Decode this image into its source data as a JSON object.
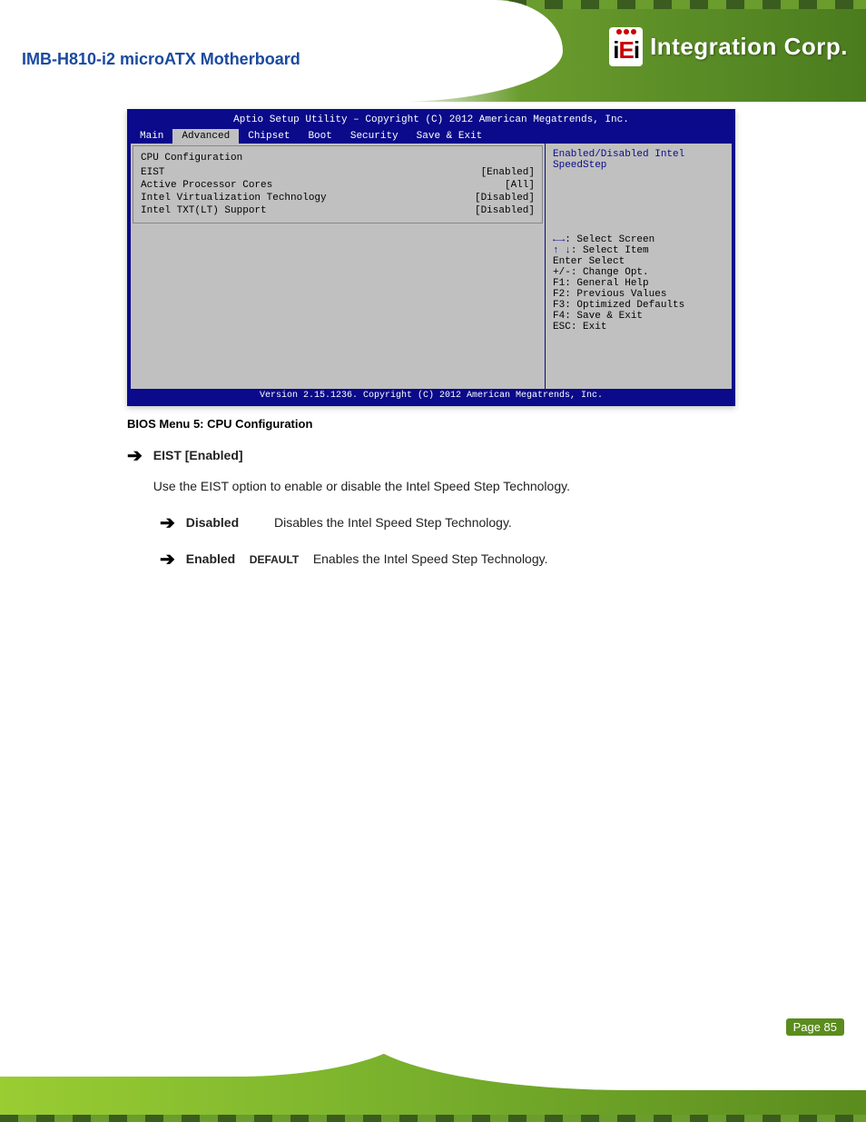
{
  "product_title": "IMB-H810-i2 microATX Motherboard",
  "brand": {
    "logo_text_1": "i",
    "logo_text_2": "E",
    "logo_text_3": "i",
    "tagline": "Integration Corp."
  },
  "bios": {
    "setup_title": "Aptio Setup Utility – Copyright (C) 2012 American Megatrends, Inc.",
    "tabs": [
      "Main",
      "Advanced",
      "Chipset",
      "Boot",
      "Security",
      "Save & Exit"
    ],
    "active_tab_index": 1,
    "left_rows": [
      {
        "opt": "CPU Configuration",
        "val": ""
      },
      {
        "opt": "",
        "val": ""
      },
      {
        "opt": "EIST",
        "val": "[Enabled]"
      },
      {
        "opt": "Active Processor Cores",
        "val": "[All]"
      },
      {
        "opt": "Intel Virtualization Technology",
        "val": "[Disabled]"
      },
      {
        "opt": "Intel TXT(LT) Support",
        "val": "[Disabled]"
      }
    ],
    "help_text": "Enabled/Disabled Intel SpeedStep",
    "keys": [
      {
        "sym": "←→",
        "txt": ": Select Screen"
      },
      {
        "sym": "↑ ↓",
        "txt": ": Select Item"
      },
      {
        "sym": "Enter",
        "txt": "Select"
      },
      {
        "sym": "+/-",
        "txt": ": Change Opt."
      },
      {
        "sym": "F1",
        "txt": ": General Help"
      },
      {
        "sym": "F2",
        "txt": ": Previous Values"
      },
      {
        "sym": "F3",
        "txt": ": Optimized Defaults"
      },
      {
        "sym": "F4",
        "txt": ": Save & Exit"
      },
      {
        "sym": "ESC",
        "txt": ": Exit"
      }
    ],
    "footer": "Version 2.15.1236. Copyright (C) 2012 American Megatrends, Inc."
  },
  "figure_caption": "BIOS Menu 5: CPU Configuration",
  "eist_block": {
    "heading": "EIST [Enabled]",
    "body": "Use the EIST option to enable or disable the Intel Speed Step Technology."
  },
  "eist_options": [
    {
      "label": "Disabled",
      "desc": "Disables the Intel Speed Step Technology."
    },
    {
      "label": "Enabled",
      "def": "DEFAULT",
      "desc": "Enables the Intel Speed Step Technology."
    }
  ],
  "page_label": "Page 85"
}
